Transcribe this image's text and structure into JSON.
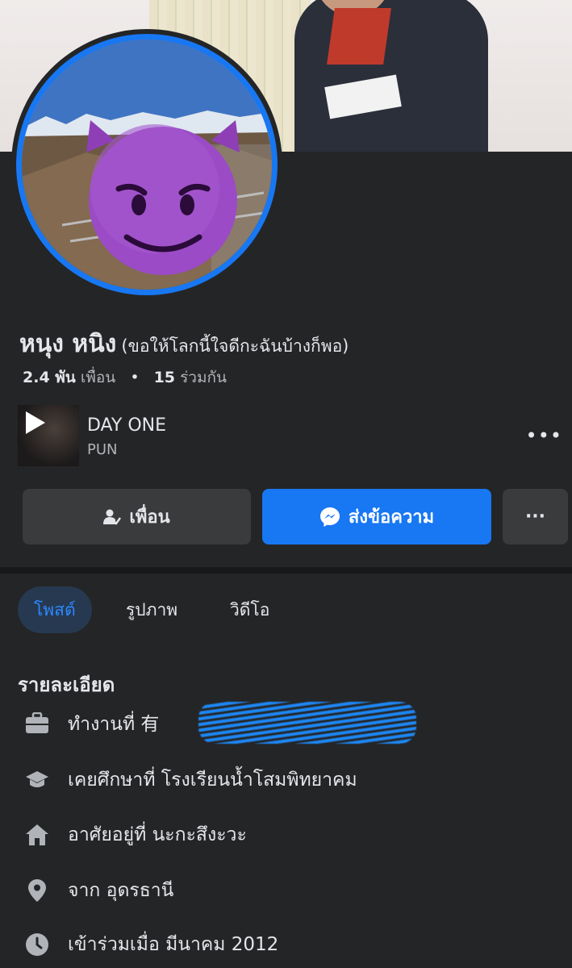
{
  "profile": {
    "name": "หนุง หนิง",
    "alternate_name": "(ขอให้โลกนี้ใจดีกะฉันบ้างก็พอ)",
    "friends_count": "2.4 พัน",
    "friends_label": "เพื่อน",
    "mutual_count": "15",
    "mutual_label": "ร่วมกัน",
    "separator": "•"
  },
  "music": {
    "title": "DAY ONE",
    "artist": "PUN",
    "more_label": "•••"
  },
  "actions": {
    "friend_label": "เพื่อน",
    "message_label": "ส่งข้อความ",
    "more_label": "···"
  },
  "tabs": [
    {
      "label": "โพสต์",
      "active": true
    },
    {
      "label": "รูปภาพ",
      "active": false
    },
    {
      "label": "วิดีโอ",
      "active": false
    }
  ],
  "details": {
    "title": "รายละเอียด",
    "items": [
      {
        "icon": "briefcase-icon",
        "text": "ทำงานที่ 有"
      },
      {
        "icon": "graduation-cap-icon",
        "text": "เคยศึกษาที่ โรงเรียนน้ำโสมพิทยาคม"
      },
      {
        "icon": "home-icon",
        "text": "อาศัยอยู่ที่ นะกะสึงะวะ"
      },
      {
        "icon": "location-pin-icon",
        "text": "จาก อุดรธานี"
      },
      {
        "icon": "clock-icon",
        "text": "เข้าร่วมเมื่อ มีนาคม 2012"
      }
    ]
  },
  "colors": {
    "background": "#242526",
    "accent": "#1877f2",
    "active_tab_bg": "#263951",
    "active_tab_text": "#2d88ff",
    "button_gray": "#3a3b3c"
  }
}
